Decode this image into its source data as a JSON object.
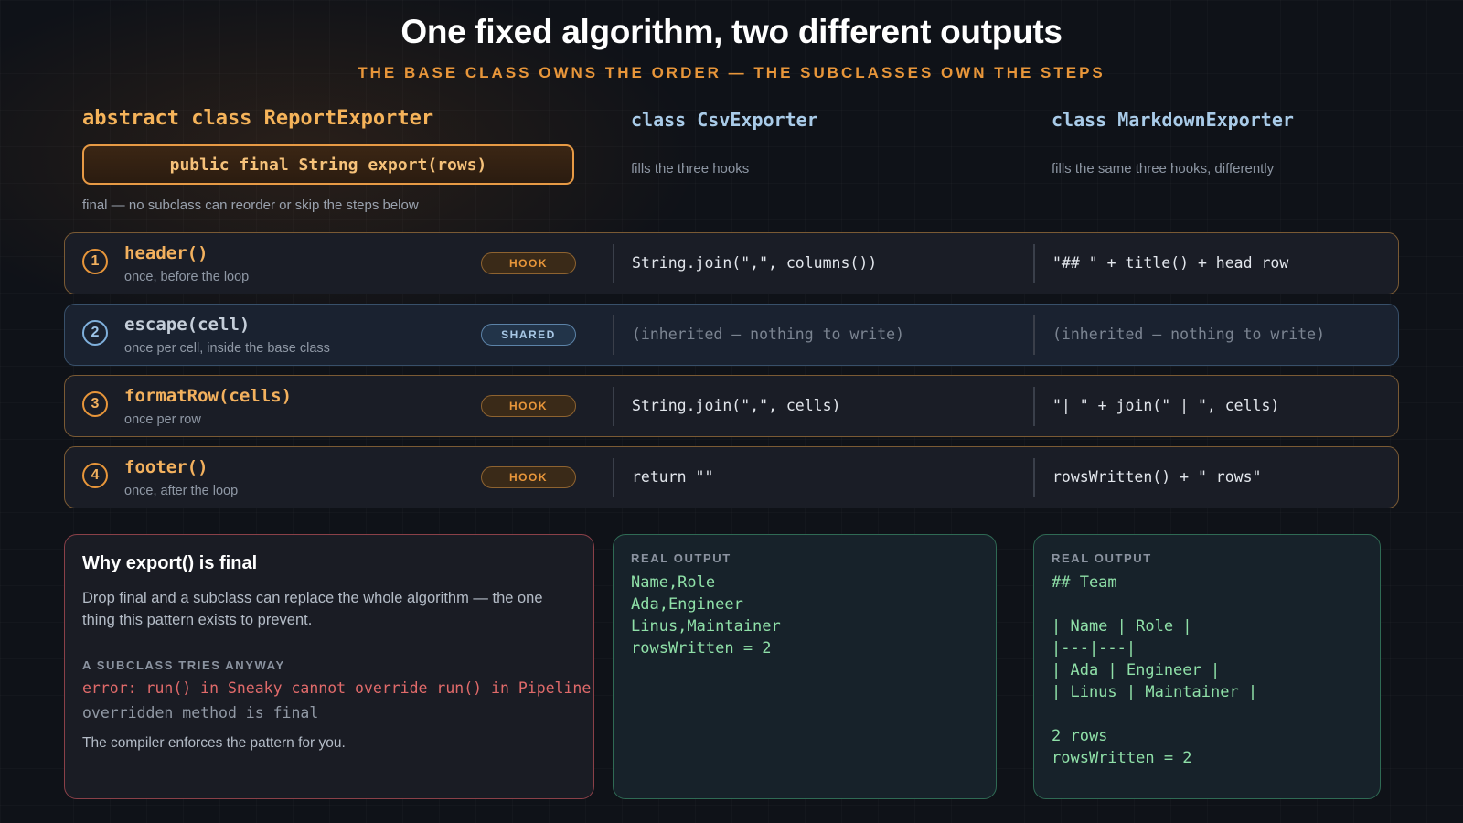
{
  "header": {
    "title": "One fixed algorithm, two different outputs",
    "subtitle": "THE BASE CLASS OWNS THE ORDER — THE SUBCLASSES OWN THE STEPS"
  },
  "columns": {
    "base": {
      "title": "abstract class ReportExporter",
      "signature": "public final String export(rows)",
      "note": "final — no subclass can reorder or skip the steps below"
    },
    "csv": {
      "title": "class CsvExporter",
      "note": "fills the three hooks"
    },
    "markdown": {
      "title": "class MarkdownExporter",
      "note": "fills the same three hooks, differently"
    }
  },
  "steps": [
    {
      "num": "1",
      "name": "header()",
      "desc": "once, before the loop",
      "badge": "HOOK",
      "kind": "hook",
      "csv": "String.join(\",\", columns())",
      "md": "\"## \" + title() + head row"
    },
    {
      "num": "2",
      "name": "escape(cell)",
      "desc": "once per cell, inside the base class",
      "badge": "SHARED",
      "kind": "shared",
      "csv": "(inherited — nothing to write)",
      "md": "(inherited — nothing to write)"
    },
    {
      "num": "3",
      "name": "formatRow(cells)",
      "desc": "once per row",
      "badge": "HOOK",
      "kind": "hook",
      "csv": "String.join(\",\", cells)",
      "md": "\"| \" + join(\" | \", cells)"
    },
    {
      "num": "4",
      "name": "footer()",
      "desc": "once, after the loop",
      "badge": "HOOK",
      "kind": "hook",
      "csv": "return \"\"",
      "md": "rowsWritten() + \" rows\""
    }
  ],
  "why": {
    "title": "Why export() is final",
    "body": "Drop final and a subclass can replace the whole algorithm — the one thing this pattern exists to prevent.",
    "subheading": "A SUBCLASS TRIES ANYWAY",
    "error_line1": "error: run() in Sneaky cannot override run() in Pipeline",
    "error_line2": "overridden method is final",
    "footer": "The compiler enforces the pattern for you."
  },
  "csv_output": {
    "label": "REAL OUTPUT",
    "lines": [
      "Name,Role",
      "Ada,Engineer",
      "Linus,Maintainer",
      "rowsWritten = 2"
    ]
  },
  "md_output": {
    "label": "REAL OUTPUT",
    "lines": [
      "## Team",
      "",
      "| Name | Role |",
      "|---|---|",
      "| Ada | Engineer |",
      "| Linus | Maintainer |",
      "",
      "2 rows",
      "rowsWritten = 2"
    ]
  }
}
